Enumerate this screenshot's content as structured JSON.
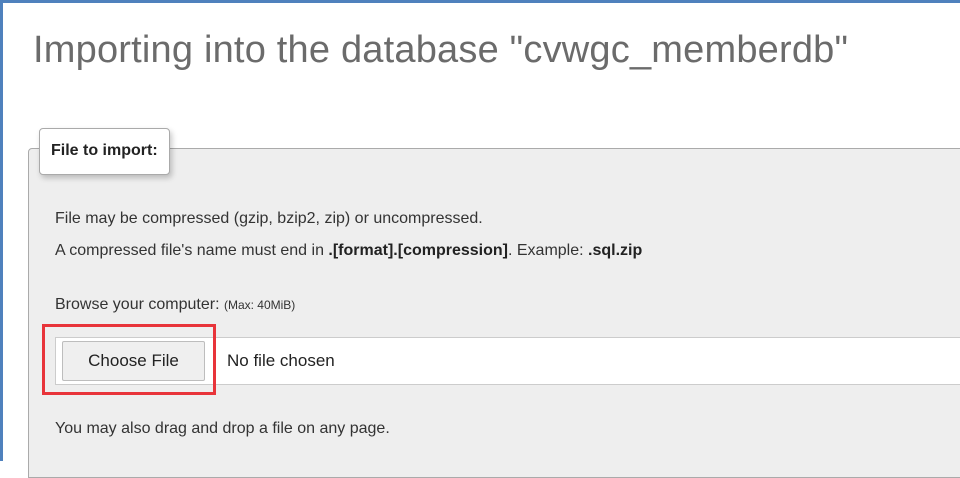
{
  "page": {
    "title": "Importing into the database \"cvwgc_memberdb\""
  },
  "import_section": {
    "legend": "File to import:",
    "compression_note": "File may be compressed (gzip, bzip2, zip) or uncompressed.",
    "name_note_prefix": "A compressed file's name must end in ",
    "name_note_format": ".[format].[compression]",
    "name_note_middle": ". Example: ",
    "name_note_example": ".sql.zip",
    "browse_label": "Browse your computer: ",
    "max_size": "(Max: 40MiB)",
    "choose_file_label": "Choose File",
    "no_file_text": "No file chosen",
    "drag_drop_note": "You may also drag and drop a file on any page."
  },
  "colors": {
    "frame_border": "#4f81bd",
    "highlight_border": "#e8343a",
    "section_background": "#eeeeee",
    "title_text": "#6b6b6b"
  }
}
